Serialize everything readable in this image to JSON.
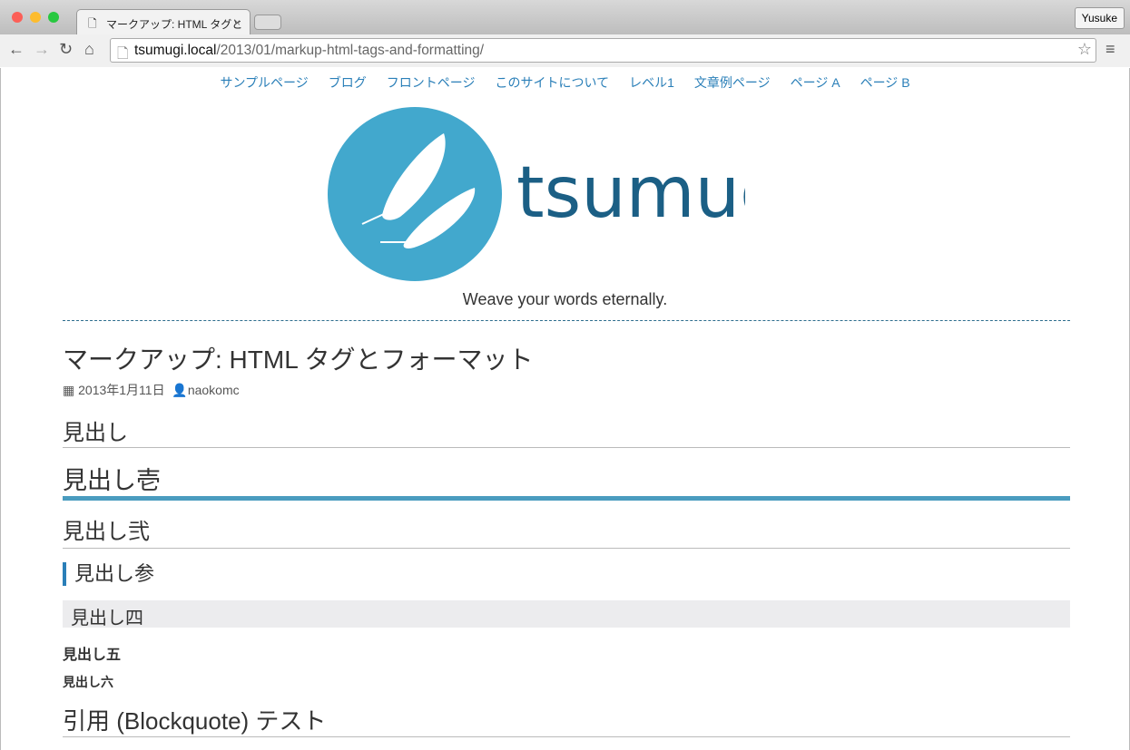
{
  "browser": {
    "tab_title": "マークアップ: HTML タグと",
    "url_host": "tsumugi.local",
    "url_path": "/2013/01/markup-html-tags-and-formatting/",
    "profile": "Yusuke",
    "close": "×"
  },
  "nav": [
    "サンプルページ",
    "ブログ",
    "フロントページ",
    "このサイトについて",
    "レベル1",
    "文章例ページ",
    "ページ A",
    "ページ B"
  ],
  "site": {
    "name": "tsumugi",
    "tagline": "Weave your words eternally.",
    "brand_color": "#42a8cd",
    "text_color": "#1b5f85"
  },
  "post": {
    "title": "マークアップ: HTML タグとフォーマット",
    "date": "2013年1月11日",
    "author": "naokomc"
  },
  "headings": {
    "h": "見出し",
    "h1": "見出し壱",
    "h2": "見出し弐",
    "h3": "見出し参",
    "h4": "見出し四",
    "h5": "見出し五",
    "h6": "見出し六",
    "blockquote": "引用 (Blockquote) テスト"
  }
}
